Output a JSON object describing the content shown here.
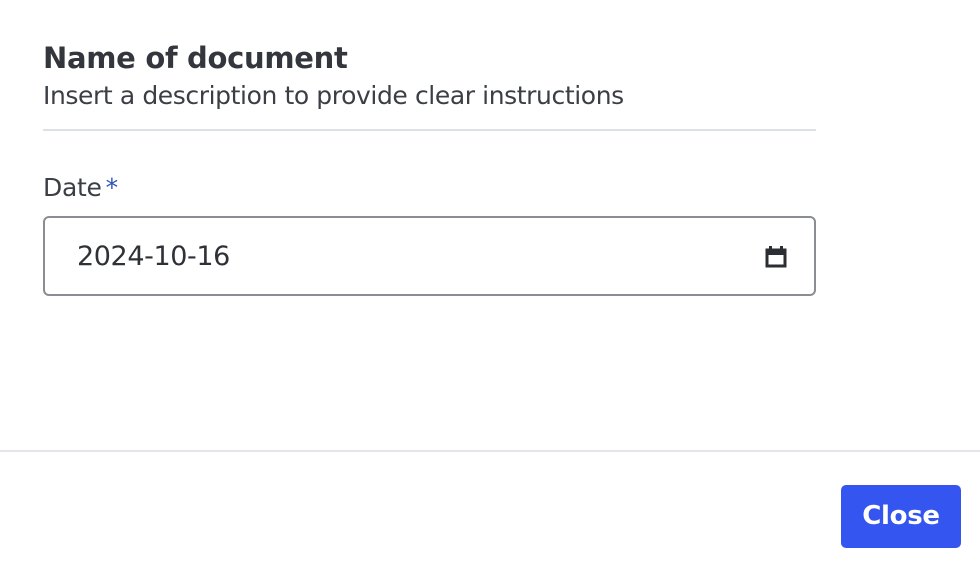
{
  "document": {
    "title": "Name of document",
    "description": "Insert a description to provide clear instructions"
  },
  "date_field": {
    "label": "Date",
    "required_marker": "*",
    "value": "2024-10-16",
    "icon": "calendar-icon"
  },
  "footer": {
    "close_label": "Close"
  },
  "colors": {
    "accent": "#3455f0",
    "required": "#2f52b8",
    "border": "#8a8d91",
    "divider": "#dde1e6"
  }
}
